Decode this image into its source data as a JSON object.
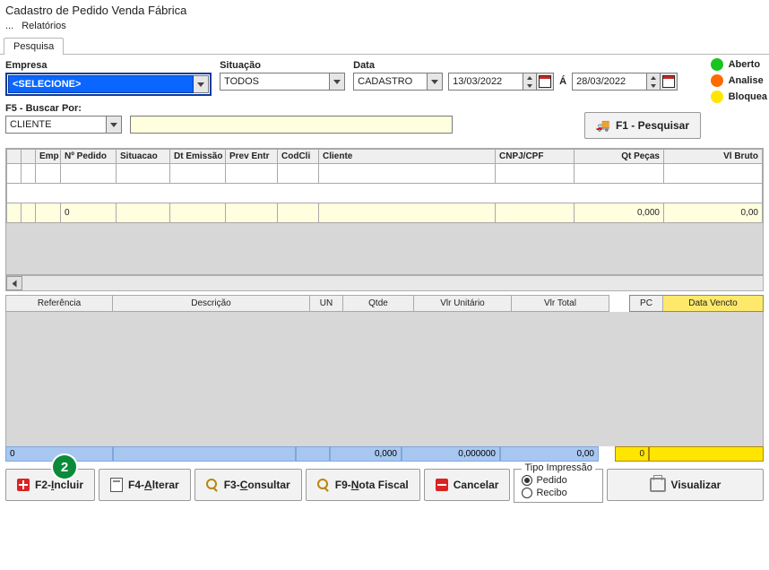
{
  "title": "Cadastro de Pedido Venda Fábrica",
  "menu": {
    "dots": "...",
    "relatorios": "Relatórios"
  },
  "tab": {
    "pesquisa": "Pesquisa"
  },
  "filters": {
    "empresa_lbl": "Empresa",
    "empresa_val": "<SELECIONE>",
    "situacao_lbl": "Situação",
    "situacao_val": "TODOS",
    "data_lbl": "Data",
    "data_tipo": "CADASTRO",
    "data_de": "13/03/2022",
    "data_a_sep": "Á",
    "data_ate": "28/03/2022",
    "buscar_lbl": "F5 - Buscar Por:",
    "buscar_val": "CLIENTE",
    "pesquisar_btn": "F1 - Pesquisar"
  },
  "legend": {
    "aberto": "Aberto",
    "analise": "Analise",
    "bloquea": "Bloquea"
  },
  "grid": {
    "cols": {
      "emp": "Emp",
      "npedido": "Nº Pedido",
      "situacao": "Situacao",
      "dtemissao": "Dt Emissão",
      "preventr": "Prev Entr",
      "codcli": "CodCli",
      "cliente": "Cliente",
      "cnpjcpf": "CNPJ/CPF",
      "qtpecas": "Qt Peças",
      "vlbruto": "Vl Bruto"
    },
    "footer": {
      "zero": "0",
      "qtpecas": "0,000",
      "vlbruto": "0,00"
    }
  },
  "grid2": {
    "cols": {
      "referencia": "Referência",
      "descricao": "Descrição",
      "un": "UN",
      "qtde": "Qtde",
      "vlrunit": "Vlr Unitário",
      "vlrtotal": "Vlr Total",
      "pc": "PC",
      "dtvencto": "Data Vencto"
    },
    "footer": {
      "zero": "0",
      "qtde": "0,000",
      "vlrunit": "0,000000",
      "vlrtotal": "0,00",
      "yzero": "0"
    }
  },
  "buttons": {
    "incluir_pre": "F2-",
    "incluir_u": "I",
    "incluir_post": "ncluir",
    "alterar_pre": "F4-",
    "alterar_u": "A",
    "alterar_post": "lterar",
    "consultar_pre": "F3-",
    "consultar_u": "C",
    "consultar_post": "onsultar",
    "notafiscal_pre": "F9-",
    "notafiscal_u": "N",
    "notafiscal_post": "ota Fiscal",
    "cancelar": "Cancelar",
    "visualizar": "Visualizar"
  },
  "tipo_impressao": {
    "legend": "Tipo Impressão",
    "pedido": "Pedido",
    "recibo": "Recibo"
  },
  "badge": "2"
}
